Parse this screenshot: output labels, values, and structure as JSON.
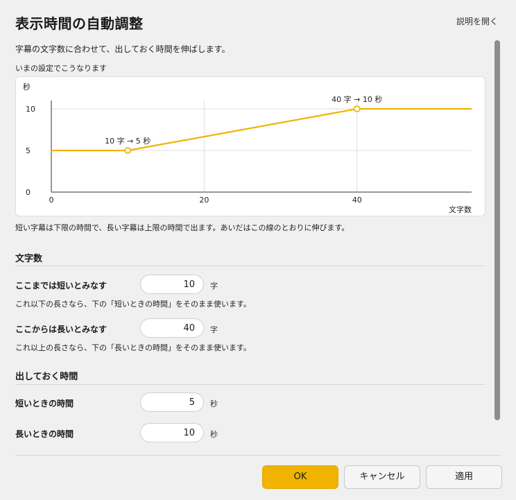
{
  "title": "表示時間の自動調整",
  "help_link": "説明を開く",
  "description": "字幕の文字数に合わせて、出しておく時間を伸ばします。",
  "preview_label": "いまの設定でこうなります",
  "chart_note": "短い字幕は下限の時間で、長い字幕は上限の時間で出ます。あいだはこの線のとおりに伸びます。",
  "chart_data": {
    "type": "line",
    "ylabel": "秒",
    "xlabel": "文字数",
    "xlim": [
      0,
      55
    ],
    "ylim": [
      0,
      10
    ],
    "x_ticks": [
      0,
      20,
      40
    ],
    "y_ticks": [
      0,
      5,
      10
    ],
    "grid": true,
    "series": [
      {
        "points": [
          [
            0,
            5
          ],
          [
            10,
            5
          ],
          [
            40,
            10
          ],
          [
            55,
            10
          ]
        ],
        "color": "#f0b400"
      }
    ],
    "markers": [
      {
        "x": 10,
        "y": 5,
        "label": "10 字 → 5 秒"
      },
      {
        "x": 40,
        "y": 10,
        "label": "40 字 → 10 秒"
      }
    ]
  },
  "sections": {
    "chars": {
      "title": "文字数",
      "short": {
        "label": "ここまでは短いとみなす",
        "value": "10",
        "unit": "字",
        "hint": "これ以下の長さなら、下の「短いときの時間」をそのまま使います。"
      },
      "long": {
        "label": "ここからは長いとみなす",
        "value": "40",
        "unit": "字",
        "hint": "これ以上の長さなら、下の「長いときの時間」をそのまま使います。"
      }
    },
    "time": {
      "title": "出しておく時間",
      "short": {
        "label": "短いときの時間",
        "value": "5",
        "unit": "秒"
      },
      "long": {
        "label": "長いときの時間",
        "value": "10",
        "unit": "秒"
      }
    }
  },
  "buttons": {
    "ok": "OK",
    "cancel": "キャンセル",
    "apply": "適用"
  }
}
